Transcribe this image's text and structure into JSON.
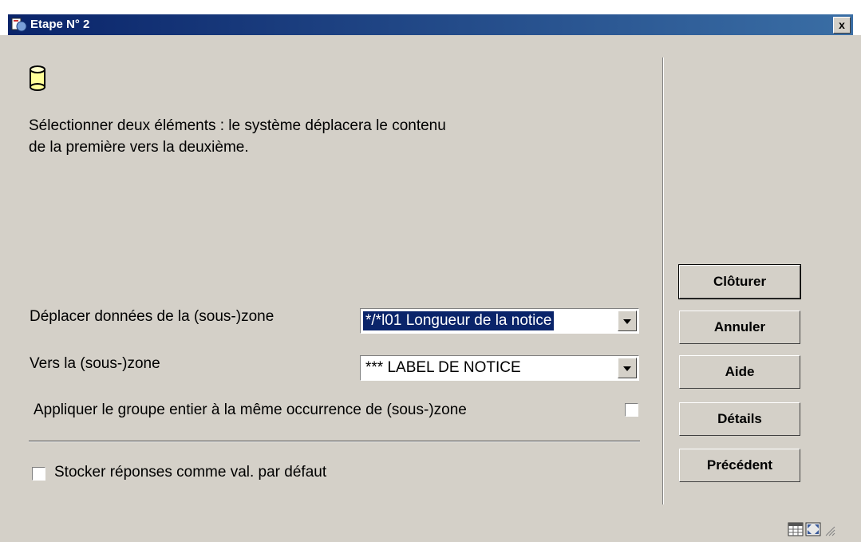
{
  "window": {
    "title": "Etape N° 2",
    "close_label": "x"
  },
  "description": {
    "line1": "Sélectionner deux éléments : le système déplacera le contenu",
    "line2": "de la première vers la deuxième."
  },
  "form": {
    "source_label": "Déplacer données de la (sous-)zone",
    "source_value": "*/*l01 Longueur de la notice",
    "target_label": "Vers la (sous-)zone",
    "target_value": "*** LABEL DE NOTICE",
    "apply_group_label": "Appliquer le groupe entier à la même occurrence de (sous-)zone",
    "apply_group_checked": false,
    "store_defaults_label": "Stocker réponses comme val. par défaut",
    "store_defaults_checked": false
  },
  "buttons": {
    "close": "Clôturer",
    "cancel": "Annuler",
    "help": "Aide",
    "details": "Détails",
    "previous": "Précédent"
  },
  "icons": [
    "app-icon",
    "database-icon",
    "calendar-icon",
    "resize-icon",
    "size-grip-icon"
  ]
}
